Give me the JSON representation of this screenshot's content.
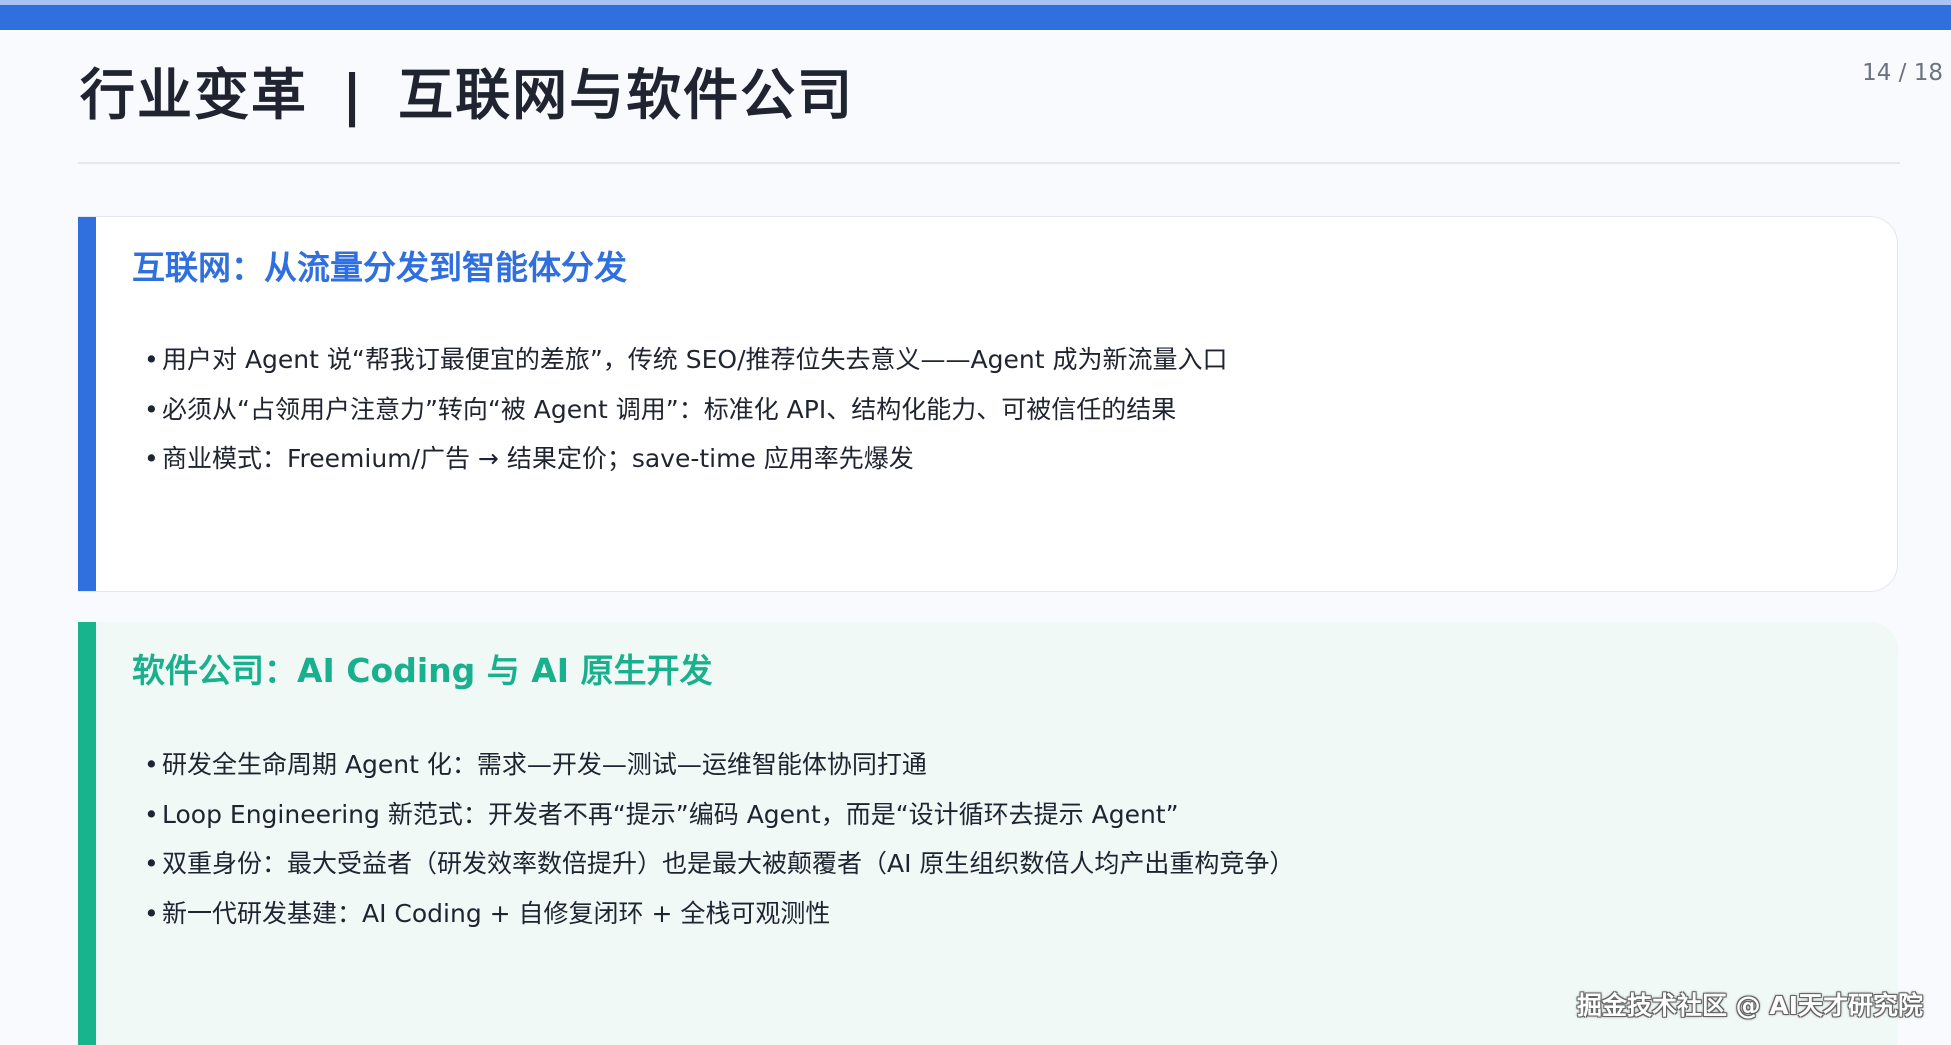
{
  "header": {
    "title_left": "行业变革",
    "title_sep": "|",
    "title_right": "互联网与软件公司",
    "page_number": "14 / 18"
  },
  "cards": [
    {
      "heading": "互联网：从流量分发到智能体分发",
      "bullets": [
        "用户对 Agent 说“帮我订最便宜的差旅”，传统 SEO/推荐位失去意义——Agent 成为新流量入口",
        "必须从“占领用户注意力”转向“被 Agent 调用”：标准化 API、结构化能力、可被信任的结果",
        "商业模式：Freemium/广告 → 结果定价；save-time 应用率先爆发"
      ]
    },
    {
      "heading": "软件公司：AI Coding 与 AI 原生开发",
      "bullets": [
        "研发全生命周期 Agent 化：需求—开发—测试—运维智能体协同打通",
        "Loop Engineering 新范式：开发者不再“提示”编码 Agent，而是“设计循环去提示 Agent”",
        "双重身份：最大受益者（研发效率数倍提升）也是最大被颠覆者（AI 原生组织数倍人均产出重构竞争）",
        "新一代研发基建：AI Coding + 自修复闭环 + 全栈可观测性"
      ]
    }
  ],
  "bullet_glyph": "•",
  "watermark": "掘金技术社区 @ AI天才研究院",
  "colors": {
    "accent_blue": "#2f6fde",
    "accent_green": "#17b48e"
  }
}
